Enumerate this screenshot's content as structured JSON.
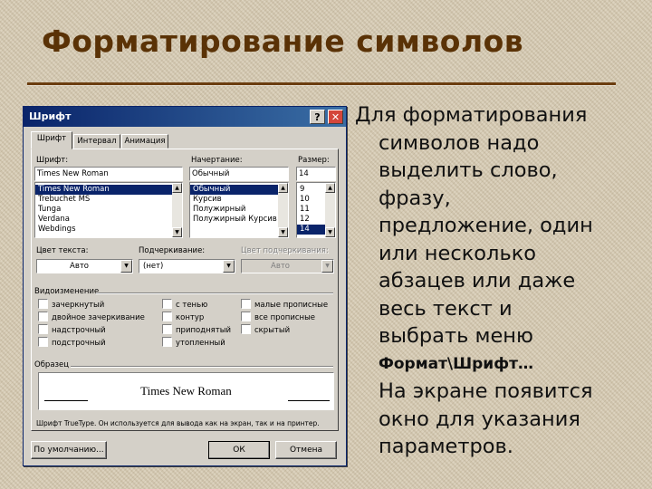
{
  "slide": {
    "title": "Форматирование символов",
    "body_lines": [
      "Для форматирования",
      "символов надо",
      "выделить слово,",
      "фразу,",
      "предложение, один",
      "или несколько",
      "абзацев или даже",
      "весь текст и",
      "выбрать меню"
    ],
    "menu_path": "Формат\\Шрифт…",
    "after_lines": [
      "На экране появится",
      "окно для указания",
      "параметров."
    ]
  },
  "dialog": {
    "title": "Шрифт",
    "help_button": "?",
    "close_button": "✕",
    "tabs": [
      "Шрифт",
      "Интервал",
      "Анимация"
    ],
    "font": {
      "label": "Шрифт:",
      "value": "Times New Roman",
      "items": [
        "Times New Roman",
        "Trebuchet MS",
        "Tunga",
        "Verdana",
        "Webdings"
      ]
    },
    "style": {
      "label": "Начертание:",
      "value": "Обычный",
      "items": [
        "Обычный",
        "Курсив",
        "Полужирный",
        "Полужирный Курсив"
      ]
    },
    "size": {
      "label": "Размер:",
      "value": "14",
      "items": [
        "9",
        "10",
        "11",
        "12",
        "14"
      ]
    },
    "color": {
      "label": "Цвет текста:",
      "value": "Авто"
    },
    "underline": {
      "label": "Подчеркивание:",
      "value": "(нет)"
    },
    "underline_color": {
      "label": "Цвет подчеркивания:",
      "value": "Авто"
    },
    "effects": {
      "label": "Видоизменение",
      "items": [
        "зачеркнутый",
        "двойное зачеркивание",
        "надстрочный",
        "подстрочный",
        "с тенью",
        "контур",
        "приподнятый",
        "утопленный",
        "малые прописные",
        "все прописные",
        "скрытый"
      ]
    },
    "preview": {
      "label": "Образец",
      "text": "Times New Roman"
    },
    "note": "Шрифт TrueType. Он используется для вывода как на экран, так и на принтер.",
    "buttons": {
      "default": "По умолчанию...",
      "ok": "ОК",
      "cancel": "Отмена"
    }
  }
}
